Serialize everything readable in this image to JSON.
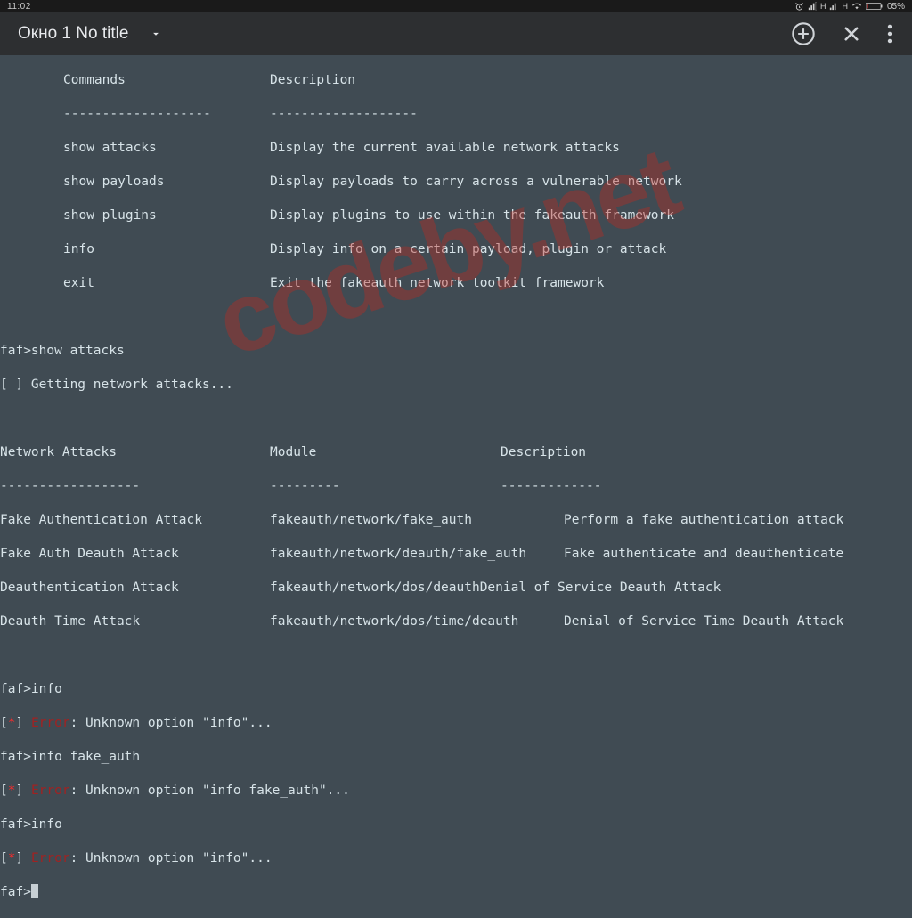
{
  "status": {
    "time": "11:02",
    "battery": "05%"
  },
  "app": {
    "tab_title": "Окно 1 No title"
  },
  "watermark": "codeby.net",
  "term": {
    "hdr_commands": "Commands",
    "hdr_description": "Description",
    "dash1": "-------------------",
    "dash2": "-------------------",
    "cmd1": "show attacks",
    "desc1": "Display the current available network attacks",
    "cmd2": "show payloads",
    "desc2": "Display payloads to carry across a vulnerable network",
    "cmd3": "show plugins",
    "desc3": "Display plugins to use within the fakeauth framework",
    "cmd4": "info",
    "desc4": "Display info on a certain payload, plugin or attack",
    "cmd5": "exit",
    "desc5": "Exit the fakeauth network toolkit framework",
    "prompt1": "faf>show attacks",
    "getting": "[ ] Getting network attacks...",
    "hdr2_a": "Network Attacks",
    "hdr2_b": "Module",
    "hdr2_c": "Description",
    "dash2a": "------------------",
    "dash2b": "---------",
    "dash2c": "-------------",
    "atk1_a": "Fake Authentication Attack",
    "atk1_b": "fakeauth/network/fake_auth",
    "atk1_c": "Perform a fake authentication attack",
    "atk2_a": "Fake Auth Deauth Attack",
    "atk2_b": "fakeauth/network/deauth/fake_auth",
    "atk2_c": "Fake authenticate and deauthenticate",
    "atk3_a": "Deauthentication Attack",
    "atk3_b": "fakeauth/network/dos/deauthDenial of Service Deauth Attack",
    "atk4_a": "Deauth Time Attack",
    "atk4_b": "fakeauth/network/dos/time/deauth",
    "atk4_c": "Denial of Service Time Deauth Attack",
    "p2": "faf>info",
    "e1a": "[",
    "e1s": "*",
    "e1b": "] ",
    "e1e": "Error",
    "e1d": ": Unknown option \"info\"...",
    "p3": "faf>info fake_auth",
    "e2d": ": Unknown option \"info fake_auth\"...",
    "p4": "faf>info",
    "p5": "faf>"
  }
}
